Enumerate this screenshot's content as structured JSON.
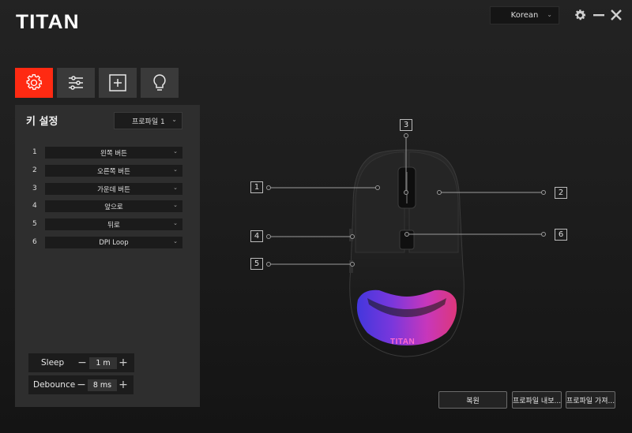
{
  "app": {
    "logo": "TITAN"
  },
  "language": {
    "selected": "Korean"
  },
  "tabs": [
    {
      "icon": "gear-icon",
      "active": true
    },
    {
      "icon": "sliders-icon",
      "active": false
    },
    {
      "icon": "macro-add-icon",
      "active": false
    },
    {
      "icon": "lightbulb-icon",
      "active": false
    }
  ],
  "key_settings": {
    "title": "키 설정",
    "profile": "프로파일 1",
    "rows": [
      {
        "num": "1",
        "value": "왼쪽 버튼"
      },
      {
        "num": "2",
        "value": "오른쪽 버튼"
      },
      {
        "num": "3",
        "value": "가운데 버튼"
      },
      {
        "num": "4",
        "value": "앞으로"
      },
      {
        "num": "5",
        "value": "뒤로"
      },
      {
        "num": "6",
        "value": "DPI Loop"
      }
    ]
  },
  "sleep": {
    "label": "Sleep",
    "minus": "−",
    "value": "1 m",
    "plus": "+"
  },
  "debounce": {
    "label": "Debounce",
    "minus": "−",
    "value": "8 ms",
    "plus": "+"
  },
  "callouts": [
    "1",
    "2",
    "3",
    "4",
    "5",
    "6"
  ],
  "mouse": {
    "logo": "TITAN"
  },
  "buttons": {
    "restore": "복원",
    "export": "프로파일 내보...",
    "import": "프로파일 가져..."
  },
  "colors": {
    "accent": "#ff2a12",
    "panel": "#2e2e2e"
  }
}
